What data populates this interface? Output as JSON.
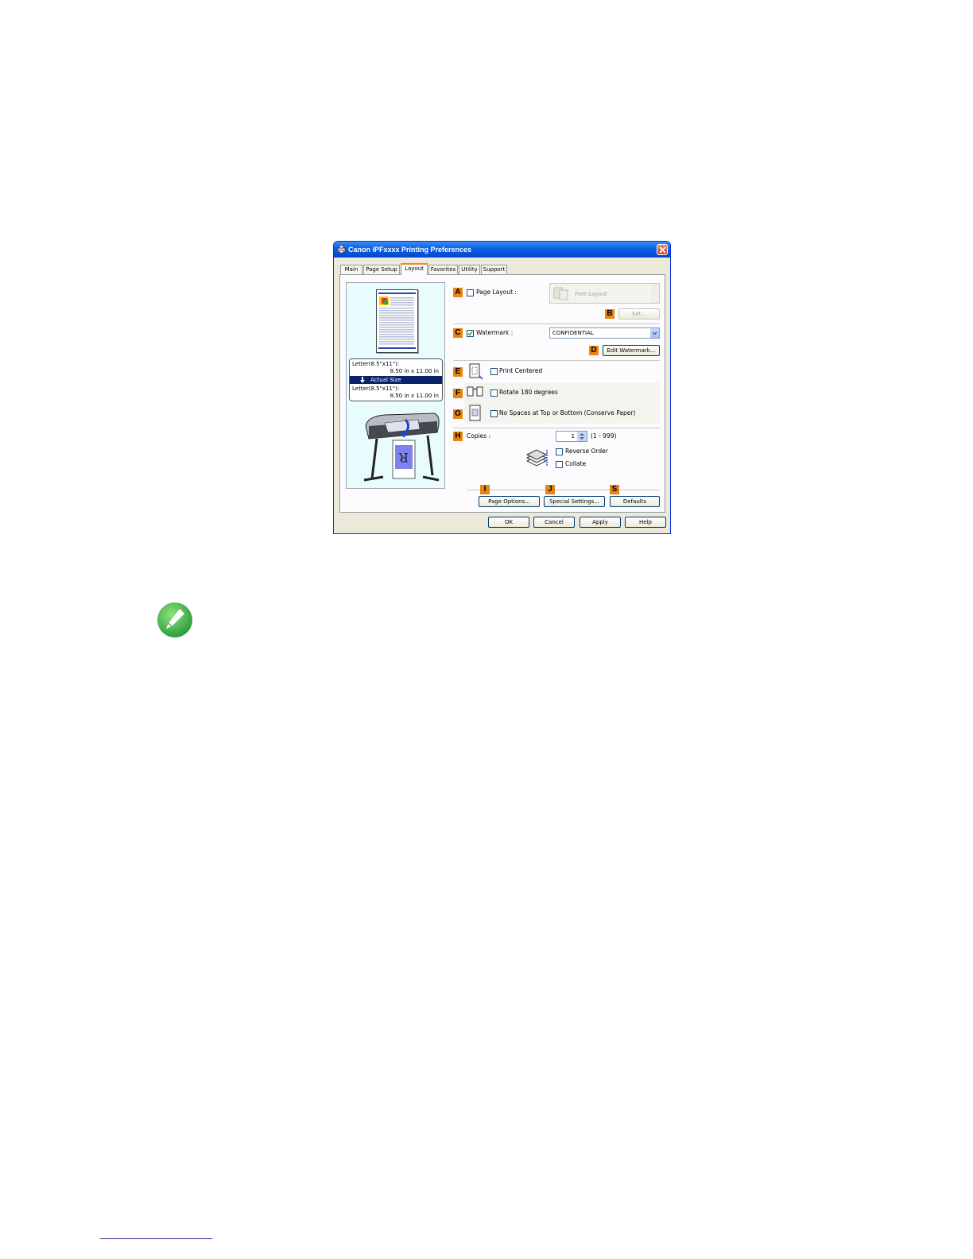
{
  "dialog": {
    "title": "Canon iPFxxxx Printing Preferences",
    "tabs": [
      "Main",
      "Page Setup",
      "Layout",
      "Favorites",
      "Utility",
      "Support"
    ],
    "active_tab": "Layout"
  },
  "preview": {
    "input_size": "Letter(8.5\"x11\"):",
    "input_dims": "8.50 in x 11.00 in",
    "scale": "Actual Size",
    "output_size": "Letter(8.5\"x11\"):",
    "output_dims": "8.50 in x 11.00 in"
  },
  "badges": {
    "a": "A",
    "b": "B",
    "c": "C",
    "d": "D",
    "e": "E",
    "f": "F",
    "g": "G",
    "h": "H",
    "i": "I",
    "j": "J",
    "s": "S"
  },
  "options": {
    "page_layout": {
      "label": "Page Layout :",
      "checked": false,
      "value": "Free Layout"
    },
    "set_button": "Set...",
    "watermark": {
      "label": "Watermark :",
      "checked": true,
      "value": "CONFIDENTIAL"
    },
    "edit_watermark_button": "Edit Watermark...",
    "print_centered": {
      "label": "Print Centered",
      "checked": false
    },
    "rotate": {
      "label": "Rotate 180 degrees",
      "checked": false
    },
    "no_spaces": {
      "label": "No Spaces at Top or Bottom (Conserve Paper)",
      "checked": false
    },
    "copies": {
      "label": "Copies :",
      "value": "1",
      "range": "(1 - 999)"
    },
    "reverse_order": {
      "label": "Reverse Order",
      "checked": false
    },
    "collate": {
      "label": "Collate",
      "checked": false
    }
  },
  "buttons": {
    "page_options": "Page Options...",
    "special_settings": "Special Settings...",
    "defaults": "Defaults",
    "ok": "OK",
    "cancel": "Cancel",
    "apply": "Apply",
    "help": "Help"
  },
  "colors": {
    "titlebar": "#0a5fe6",
    "badge": "#e8850f",
    "dialog_bg": "#ece9d8",
    "note_icon": "#3bb54a"
  },
  "icons": {
    "note": "pencil-icon"
  }
}
